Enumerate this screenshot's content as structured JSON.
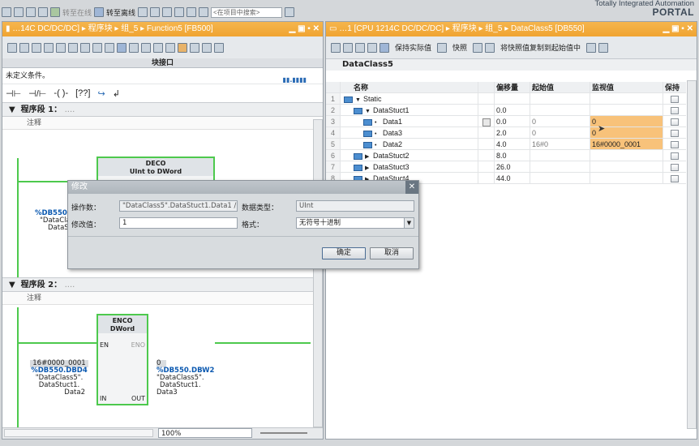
{
  "brand": {
    "line1": "Totally Integrated Automation",
    "line2": "PORTAL"
  },
  "toolbar": {
    "go_online": "转至在线",
    "go_offline": "转至离线",
    "search_placeholder": "<在项目中搜索>"
  },
  "left": {
    "title": "…14C DC/DC/DC] ▸ 程序块 ▸ 组_5 ▸ Function5 [FB500]",
    "interface_bar": "块接口",
    "condition": "未定义条件。",
    "seg1": "程序段 1：",
    "seg1_dots": "....",
    "comment": "注释",
    "seg2": "程序段 2：",
    "seg2_dots": "....",
    "deco": {
      "name": "DECO",
      "desc": "UInt to DWord"
    },
    "deco_in": {
      "addr": "%DB550.",
      "name": "\"DataCla",
      "member": "DataS"
    },
    "enco": {
      "name": "ENCO",
      "type": "DWord",
      "en": "EN",
      "eno": "ENO",
      "in": "IN",
      "out": "OUT"
    },
    "enco_in": {
      "value": "16#0000_0001",
      "addr": "%DB550.DBD4",
      "name": "\"DataClass5\".",
      "member": "DataStuct1.",
      "leaf": "Data2"
    },
    "enco_out": {
      "value": "0",
      "addr": "%DB550.DBW2",
      "name": "\"DataClass5\".",
      "member": "DataStuct1.",
      "leaf": "Data3"
    },
    "zoom": "100%"
  },
  "right": {
    "title": "…1 [CPU 1214C DC/DC/DC] ▸ 程序块 ▸ 组_5 ▸ DataClass5 [DB550]",
    "keep_actual": "保持实际值",
    "snapshot": "快照",
    "copy_snapshot": "将快照值复制到起始值中",
    "db_name": "DataClass5",
    "cols": {
      "name": "名称",
      "offset": "偏移量",
      "start": "起始值",
      "monitor": "监视值",
      "retain": "保持"
    },
    "rows": [
      {
        "no": "1",
        "name": "Static",
        "offset": "",
        "start": "",
        "monitor": "",
        "indent": 0,
        "exp": "▼"
      },
      {
        "no": "2",
        "name": "DataStuct1",
        "offset": "0.0",
        "start": "",
        "monitor": "",
        "indent": 1,
        "exp": "▼"
      },
      {
        "no": "3",
        "name": "Data1",
        "offset": "0.0",
        "start": "0",
        "monitor": "0",
        "indent": 2,
        "exp": ""
      },
      {
        "no": "4",
        "name": "Data3",
        "offset": "2.0",
        "start": "0",
        "monitor": "0",
        "indent": 2,
        "exp": ""
      },
      {
        "no": "5",
        "name": "Data2",
        "offset": "4.0",
        "start": "16#0",
        "monitor": "16#0000_0001",
        "indent": 2,
        "exp": ""
      },
      {
        "no": "6",
        "name": "DataStuct2",
        "offset": "8.0",
        "start": "",
        "monitor": "",
        "indent": 1,
        "exp": "▶"
      },
      {
        "no": "7",
        "name": "DataStuct3",
        "offset": "26.0",
        "start": "",
        "monitor": "",
        "indent": 1,
        "exp": "▶"
      },
      {
        "no": "8",
        "name": "DataStuct4",
        "offset": "44.0",
        "start": "",
        "monitor": "",
        "indent": 1,
        "exp": "▶"
      }
    ],
    "highlight_color": "#f8c27a"
  },
  "dialog": {
    "title": "修改",
    "operand_label": "操作数：",
    "operand_value": "\"DataClass5\".DataStuct1.Data1 / %",
    "dtype_label": "数据类型：",
    "dtype_value": "UInt",
    "modify_label": "修改值：",
    "modify_value": "1",
    "format_label": "格式：",
    "format_value": "无符号十进制",
    "ok": "确定",
    "cancel": "取消"
  }
}
